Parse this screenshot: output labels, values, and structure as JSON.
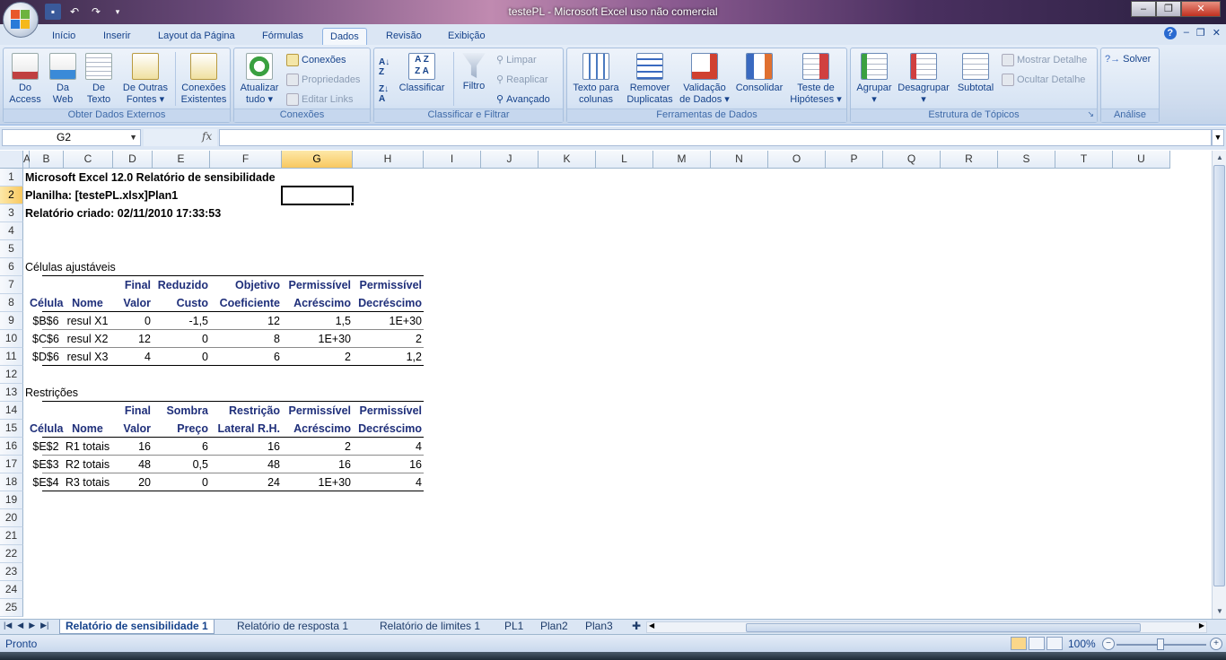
{
  "window": {
    "title": "testePL  -  Microsoft Excel uso não comercial",
    "min": "‒",
    "max": "❐",
    "close": "✕"
  },
  "ribbon_tabs": [
    "Início",
    "Inserir",
    "Layout da Página",
    "Fórmulas",
    "Dados",
    "Revisão",
    "Exibição"
  ],
  "active_tab": "Dados",
  "help": "?",
  "ribbon": {
    "groups": {
      "obter": "Obter Dados Externos",
      "conexoes": "Conexões",
      "classificar": "Classificar e Filtrar",
      "ferramentas": "Ferramentas de Dados",
      "estrutura": "Estrutura de Tópicos",
      "analise": "Análise"
    },
    "buttons": {
      "do_access_1": "Do",
      "do_access_2": "Access",
      "da_web_1": "Da",
      "da_web_2": "Web",
      "de_texto_1": "De",
      "de_texto_2": "Texto",
      "outras_1": "De Outras",
      "outras_2": "Fontes",
      "conexoes_exist_1": "Conexões",
      "conexoes_exist_2": "Existentes",
      "atualizar_1": "Atualizar",
      "atualizar_2": "tudo",
      "conexoes": "Conexões",
      "propriedades": "Propriedades",
      "editar_links": "Editar Links",
      "classificar": "Classificar",
      "filtro": "Filtro",
      "limpar": "Limpar",
      "reaplicar": "Reaplicar",
      "avancado": "Avançado",
      "texto_colunas_1": "Texto para",
      "texto_colunas_2": "colunas",
      "remover_1": "Remover",
      "remover_2": "Duplicatas",
      "validacao_1": "Validação",
      "validacao_2": "de Dados",
      "consolidar": "Consolidar",
      "teste_1": "Teste de",
      "teste_2": "Hipóteses",
      "agrupar": "Agrupar",
      "desagrupar": "Desagrupar",
      "subtotal": "Subtotal",
      "mostrar_detalhe": "Mostrar Detalhe",
      "ocultar_detalhe": "Ocultar Detalhe",
      "solver": "Solver"
    }
  },
  "formula_bar": {
    "name_box": "G2",
    "fx": "fx",
    "formula": ""
  },
  "columns": [
    "A",
    "B",
    "C",
    "D",
    "E",
    "F",
    "G",
    "H",
    "I",
    "J",
    "K",
    "L",
    "M",
    "N",
    "O",
    "P",
    "Q",
    "R",
    "S",
    "T",
    "U"
  ],
  "rows": [
    "1",
    "2",
    "3",
    "4",
    "5",
    "6",
    "7",
    "8",
    "9",
    "10",
    "11",
    "12",
    "13",
    "14",
    "15",
    "16",
    "17",
    "18",
    "19",
    "20",
    "21",
    "22",
    "23",
    "24",
    "25"
  ],
  "selected_cell": "G2",
  "report": {
    "line1": "Microsoft Excel 12.0 Relatório de sensibilidade",
    "line2": "Planilha: [testePL.xlsx]Plan1",
    "line3": "Relatório criado: 02/11/2010 17:33:53",
    "adjustable_title": "Células ajustáveis",
    "adjustable_headers_row1": [
      "",
      "",
      "Final",
      "Reduzido",
      "Objetivo",
      "Permissível",
      "Permissível"
    ],
    "adjustable_headers_row2": [
      "Célula",
      "Nome",
      "Valor",
      "Custo",
      "Coeficiente",
      "Acréscimo",
      "Decréscimo"
    ],
    "adjustable_rows": [
      [
        "$B$6",
        "resul X1",
        "0",
        "-1,5",
        "12",
        "1,5",
        "1E+30"
      ],
      [
        "$C$6",
        "resul X2",
        "12",
        "0",
        "8",
        "1E+30",
        "2"
      ],
      [
        "$D$6",
        "resul X3",
        "4",
        "0",
        "6",
        "2",
        "1,2"
      ]
    ],
    "constraints_title": "Restrições",
    "constraint_headers_row1": [
      "",
      "",
      "Final",
      "Sombra",
      "Restrição",
      "Permissível",
      "Permissível"
    ],
    "constraint_headers_row2": [
      "Célula",
      "Nome",
      "Valor",
      "Preço",
      "Lateral R.H.",
      "Acréscimo",
      "Decréscimo"
    ],
    "constraint_rows": [
      [
        "$E$2",
        "R1 totais",
        "16",
        "6",
        "16",
        "2",
        "4"
      ],
      [
        "$E$3",
        "R2 totais",
        "48",
        "0,5",
        "48",
        "16",
        "16"
      ],
      [
        "$E$4",
        "R3 totais",
        "20",
        "0",
        "24",
        "1E+30",
        "4"
      ]
    ]
  },
  "sheet_tabs": [
    "Relatório de sensibilidade 1",
    "Relatório de resposta 1",
    "Relatório de limites 1",
    "PL1",
    "Plan2",
    "Plan3"
  ],
  "active_sheet": "Relatório de sensibilidade 1",
  "status": {
    "text": "Pronto",
    "zoom": "100%"
  }
}
